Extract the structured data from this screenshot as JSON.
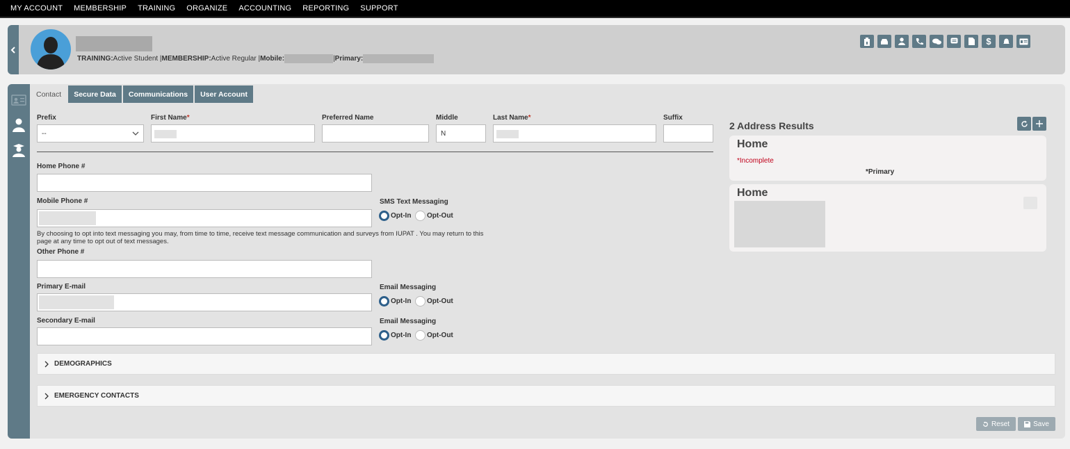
{
  "nav": {
    "items": [
      "MY ACCOUNT",
      "MEMBERSHIP",
      "TRAINING",
      "ORGANIZE",
      "ACCOUNTING",
      "REPORTING",
      "SUPPORT"
    ]
  },
  "header": {
    "training_label": "TRAINING:",
    "training_value": " Active Student | ",
    "membership_label": "MEMBERSHIP:",
    "membership_value": " Active Regular | ",
    "mobile_label": "Mobile:",
    "primary_sep": " | ",
    "primary_label": "Primary:",
    "icons": [
      "clipboard-badge-icon",
      "inbox-icon",
      "user-icon",
      "phone-icon",
      "chat-icon",
      "message-icon",
      "document-icon",
      "dollar-icon",
      "bell-icon",
      "id-card-icon"
    ]
  },
  "tabs": [
    "Contact",
    "Secure Data",
    "Communications",
    "User Account"
  ],
  "form": {
    "prefix_label": "Prefix",
    "prefix_value": "--",
    "first_name_label": "First Name",
    "preferred_name_label": "Preferred Name",
    "middle_label": "Middle",
    "middle_value": "N",
    "last_name_label": "Last Name",
    "suffix_label": "Suffix",
    "required_mark": "*",
    "home_phone_label": "Home Phone #",
    "mobile_phone_label": "Mobile Phone #",
    "sms_label": "SMS Text Messaging",
    "opt_in": "Opt-In",
    "opt_out": "Opt-Out",
    "sms_note": "By choosing to opt into text messaging you may, from time to time, receive text message communication and surveys from IUPAT . You may return to this page at any time to opt out of text messages.",
    "other_phone_label": "Other Phone #",
    "primary_email_label": "Primary E-mail",
    "email_messaging_label": "Email Messaging",
    "secondary_email_label": "Secondary E-mail"
  },
  "sections": {
    "demographics": "DEMOGRAPHICS",
    "emergency": "EMERGENCY CONTACTS"
  },
  "addresses": {
    "title": "2 Address Results",
    "cards": [
      {
        "title": "Home",
        "status": "*Incomplete",
        "primary": "*Primary"
      },
      {
        "title": "Home"
      }
    ]
  },
  "buttons": {
    "reset": "Reset",
    "save": "Save"
  },
  "colors": {
    "accent": "#5f7a87",
    "radio_on": "#2d5f8a",
    "required": "#c0392b"
  }
}
